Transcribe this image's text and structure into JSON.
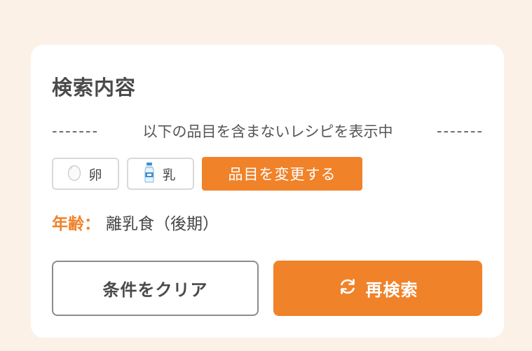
{
  "panel": {
    "title": "検索内容",
    "subtitle_dashes_left": "-------",
    "subtitle": "以下の品目を含まないレシピを表示中",
    "subtitle_dashes_right": "-------"
  },
  "items": [
    {
      "label": "卵",
      "icon": "egg-icon"
    },
    {
      "label": "乳",
      "icon": "milk-bottle-icon"
    }
  ],
  "change_button_label": "品目を変更する",
  "age": {
    "label": "年齢：",
    "value": "離乳食（後期）"
  },
  "actions": {
    "clear_label": "条件をクリア",
    "research_label": "再検索",
    "research_icon": "refresh-icon"
  },
  "colors": {
    "accent": "#f0822a",
    "background": "#fcf1e7",
    "card": "#ffffff"
  }
}
